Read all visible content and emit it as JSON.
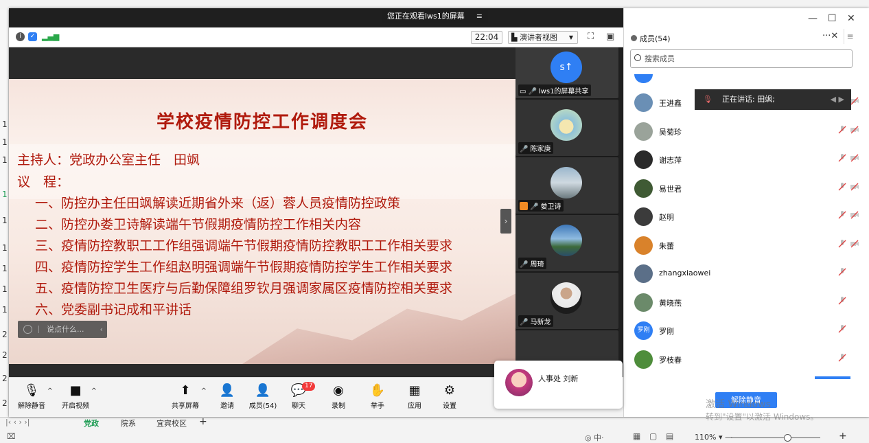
{
  "share_banner": {
    "text": "您正在观看lws1的屏幕",
    "icon": "menu-icon"
  },
  "topbar": {
    "timer": "22:04",
    "view_label": "演讲者视图"
  },
  "slide": {
    "title": "学校疫情防控工作调度会",
    "host": "主持人：党政办公室主任　田飒",
    "agenda_label": "议　程：",
    "items": [
      "一、防控办主任田飒解读近期省外来（返）蓉人员疫情防控政策",
      "二、防控办娄卫诗解读端午节假期疫情防控工作相关内容",
      "三、疫情防控教职工工作组强调端午节假期疫情防控教职工工作相关要求",
      "四、疫情防控学生工作组赵明强调端午节假期疫情防控学生工作相关要求",
      "五、疫情防控卫生医疗与后勤保障组罗钦月强调家属区疫情防控相关要求",
      "六、党委副书记成和平讲话"
    ],
    "chat_placeholder": "说点什么..."
  },
  "tiles": [
    {
      "name": "lws1的屏幕共享",
      "avatar_text": "s↑"
    },
    {
      "name": "陈家庚"
    },
    {
      "name": "娄卫诗"
    },
    {
      "name": "周琦"
    },
    {
      "name": "马新龙"
    }
  ],
  "toolbar": {
    "unmute": "解除静音",
    "video": "开启视频",
    "share": "共享屏幕",
    "invite": "邀请",
    "members": "成员(54)",
    "chat": "聊天",
    "chat_badge": "17",
    "record": "录制",
    "raise": "举手",
    "apps": "应用",
    "settings": "设置"
  },
  "speaker_popup": {
    "name": "人事处 刘新"
  },
  "panel": {
    "title": "成员(54)",
    "search_placeholder": "搜索成员",
    "speaking_tip": "正在讲话: 田飒;",
    "members": [
      {
        "name": "王进鑫",
        "color": "#6a8fb5"
      },
      {
        "name": "吴菊珍",
        "color": "#9aa39a"
      },
      {
        "name": "谢志萍",
        "color": "#2a2a2a"
      },
      {
        "name": "易世君",
        "color": "#3f5a34"
      },
      {
        "name": "赵明",
        "color": "#3b3b3b"
      },
      {
        "name": "朱蕾",
        "color": "#d9822b"
      },
      {
        "name": "zhangxiaowei",
        "color": "#5b6f88"
      },
      {
        "name": "黄晓燕",
        "color": "#6b8a6a"
      },
      {
        "name": "罗刚",
        "color": "#2f7ff4",
        "initials": "罗刚"
      },
      {
        "name": "罗枝春",
        "color": "#4e8d3b"
      }
    ],
    "unmute_all": "解除静音"
  },
  "watermark": {
    "line1": "激活 Windows",
    "line2": "转到\"设置\"以激活 Windows。"
  },
  "sheet": {
    "tabs": [
      "党政",
      "院系",
      "宜宾校区"
    ],
    "active_tab": "党政",
    "zoom": "110%"
  },
  "colors": {
    "accent": "#2f7ff4",
    "slide_red": "#b01a0d",
    "active_tab": "#1f9d55"
  }
}
